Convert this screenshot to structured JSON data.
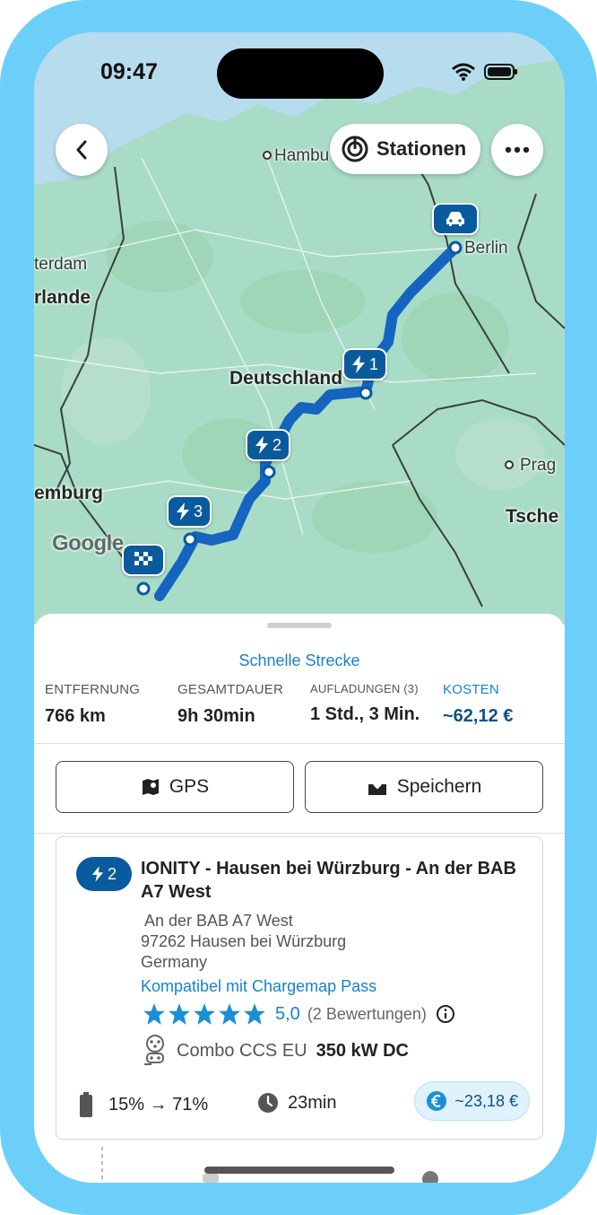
{
  "status_bar": {
    "time": "09:47"
  },
  "map": {
    "labels": {
      "hamburg": "Hambu",
      "berlin": "Berlin",
      "amsterdam": "terdam",
      "niederlande": "rlande",
      "deutschland": "Deutschland",
      "prag": "Prag",
      "luxemburg": "emburg",
      "tschechien": "Tsche"
    },
    "attribution": "Google",
    "markers": [
      {
        "kind": "bolt",
        "number": "1"
      },
      {
        "kind": "bolt",
        "number": "2"
      },
      {
        "kind": "bolt",
        "number": "3"
      }
    ],
    "route_color": "#1565c0"
  },
  "toolbar": {
    "back_icon": "chevron-left-icon",
    "stations_label": "Stationen",
    "more_icon": "more-horizontal-icon"
  },
  "route": {
    "type_label": "Schnelle Strecke",
    "stats": {
      "distance": {
        "label": "ENTFERNUNG",
        "value": "766 km"
      },
      "duration": {
        "label": "GESAMTDAUER",
        "value": "9h 30min"
      },
      "charges": {
        "label": "AUFLADUNGEN (3)",
        "value": "1 Std., 3 Min."
      },
      "cost": {
        "label": "KOSTEN",
        "value": "~62,12 €"
      }
    },
    "buttons": {
      "gps": "GPS",
      "save": "Speichern"
    }
  },
  "stop_card": {
    "badge_number": "2",
    "title": "IONITY - Hausen bei Würzburg - An der BAB A7 West",
    "address_line1": "An der BAB A7 West",
    "address_line2": "97262 Hausen bei Würzburg",
    "address_line3": "Germany",
    "compatibility": "Kompatibel mit Chargemap Pass",
    "rating": {
      "stars": 5,
      "score": "5,0",
      "count": "(2 Bewertungen)"
    },
    "connector": {
      "type": "Combo CCS EU",
      "power": "350 kW DC"
    },
    "battery": "15% → 71%",
    "charge_duration": "23min",
    "price": "~23,18 €"
  },
  "colors": {
    "accent": "#1683c9",
    "marker": "#0a5a9e",
    "frame": "#6ccffa"
  }
}
